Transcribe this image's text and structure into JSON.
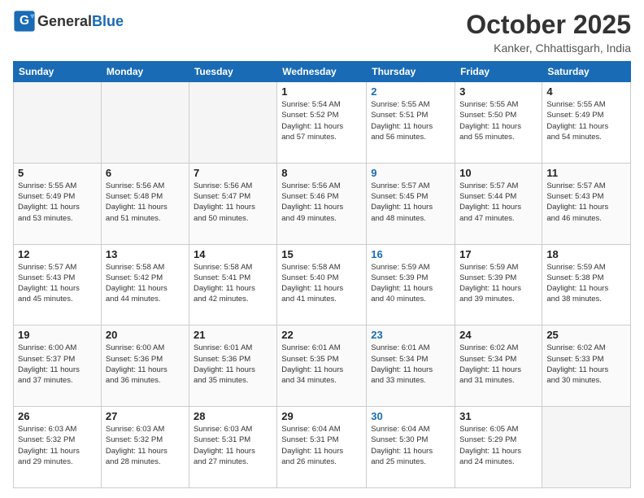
{
  "header": {
    "logo_general": "General",
    "logo_blue": "Blue",
    "month": "October 2025",
    "location": "Kanker, Chhattisgarh, India"
  },
  "days_of_week": [
    "Sunday",
    "Monday",
    "Tuesday",
    "Wednesday",
    "Thursday",
    "Friday",
    "Saturday"
  ],
  "weeks": [
    [
      {
        "day": "",
        "info": ""
      },
      {
        "day": "",
        "info": ""
      },
      {
        "day": "",
        "info": ""
      },
      {
        "day": "1",
        "info": "Sunrise: 5:54 AM\nSunset: 5:52 PM\nDaylight: 11 hours\nand 57 minutes."
      },
      {
        "day": "2",
        "info": "Sunrise: 5:55 AM\nSunset: 5:51 PM\nDaylight: 11 hours\nand 56 minutes."
      },
      {
        "day": "3",
        "info": "Sunrise: 5:55 AM\nSunset: 5:50 PM\nDaylight: 11 hours\nand 55 minutes."
      },
      {
        "day": "4",
        "info": "Sunrise: 5:55 AM\nSunset: 5:49 PM\nDaylight: 11 hours\nand 54 minutes."
      }
    ],
    [
      {
        "day": "5",
        "info": "Sunrise: 5:55 AM\nSunset: 5:49 PM\nDaylight: 11 hours\nand 53 minutes."
      },
      {
        "day": "6",
        "info": "Sunrise: 5:56 AM\nSunset: 5:48 PM\nDaylight: 11 hours\nand 51 minutes."
      },
      {
        "day": "7",
        "info": "Sunrise: 5:56 AM\nSunset: 5:47 PM\nDaylight: 11 hours\nand 50 minutes."
      },
      {
        "day": "8",
        "info": "Sunrise: 5:56 AM\nSunset: 5:46 PM\nDaylight: 11 hours\nand 49 minutes."
      },
      {
        "day": "9",
        "info": "Sunrise: 5:57 AM\nSunset: 5:45 PM\nDaylight: 11 hours\nand 48 minutes."
      },
      {
        "day": "10",
        "info": "Sunrise: 5:57 AM\nSunset: 5:44 PM\nDaylight: 11 hours\nand 47 minutes."
      },
      {
        "day": "11",
        "info": "Sunrise: 5:57 AM\nSunset: 5:43 PM\nDaylight: 11 hours\nand 46 minutes."
      }
    ],
    [
      {
        "day": "12",
        "info": "Sunrise: 5:57 AM\nSunset: 5:43 PM\nDaylight: 11 hours\nand 45 minutes."
      },
      {
        "day": "13",
        "info": "Sunrise: 5:58 AM\nSunset: 5:42 PM\nDaylight: 11 hours\nand 44 minutes."
      },
      {
        "day": "14",
        "info": "Sunrise: 5:58 AM\nSunset: 5:41 PM\nDaylight: 11 hours\nand 42 minutes."
      },
      {
        "day": "15",
        "info": "Sunrise: 5:58 AM\nSunset: 5:40 PM\nDaylight: 11 hours\nand 41 minutes."
      },
      {
        "day": "16",
        "info": "Sunrise: 5:59 AM\nSunset: 5:39 PM\nDaylight: 11 hours\nand 40 minutes."
      },
      {
        "day": "17",
        "info": "Sunrise: 5:59 AM\nSunset: 5:39 PM\nDaylight: 11 hours\nand 39 minutes."
      },
      {
        "day": "18",
        "info": "Sunrise: 5:59 AM\nSunset: 5:38 PM\nDaylight: 11 hours\nand 38 minutes."
      }
    ],
    [
      {
        "day": "19",
        "info": "Sunrise: 6:00 AM\nSunset: 5:37 PM\nDaylight: 11 hours\nand 37 minutes."
      },
      {
        "day": "20",
        "info": "Sunrise: 6:00 AM\nSunset: 5:36 PM\nDaylight: 11 hours\nand 36 minutes."
      },
      {
        "day": "21",
        "info": "Sunrise: 6:01 AM\nSunset: 5:36 PM\nDaylight: 11 hours\nand 35 minutes."
      },
      {
        "day": "22",
        "info": "Sunrise: 6:01 AM\nSunset: 5:35 PM\nDaylight: 11 hours\nand 34 minutes."
      },
      {
        "day": "23",
        "info": "Sunrise: 6:01 AM\nSunset: 5:34 PM\nDaylight: 11 hours\nand 33 minutes."
      },
      {
        "day": "24",
        "info": "Sunrise: 6:02 AM\nSunset: 5:34 PM\nDaylight: 11 hours\nand 31 minutes."
      },
      {
        "day": "25",
        "info": "Sunrise: 6:02 AM\nSunset: 5:33 PM\nDaylight: 11 hours\nand 30 minutes."
      }
    ],
    [
      {
        "day": "26",
        "info": "Sunrise: 6:03 AM\nSunset: 5:32 PM\nDaylight: 11 hours\nand 29 minutes."
      },
      {
        "day": "27",
        "info": "Sunrise: 6:03 AM\nSunset: 5:32 PM\nDaylight: 11 hours\nand 28 minutes."
      },
      {
        "day": "28",
        "info": "Sunrise: 6:03 AM\nSunset: 5:31 PM\nDaylight: 11 hours\nand 27 minutes."
      },
      {
        "day": "29",
        "info": "Sunrise: 6:04 AM\nSunset: 5:31 PM\nDaylight: 11 hours\nand 26 minutes."
      },
      {
        "day": "30",
        "info": "Sunrise: 6:04 AM\nSunset: 5:30 PM\nDaylight: 11 hours\nand 25 minutes."
      },
      {
        "day": "31",
        "info": "Sunrise: 6:05 AM\nSunset: 5:29 PM\nDaylight: 11 hours\nand 24 minutes."
      },
      {
        "day": "",
        "info": ""
      }
    ]
  ],
  "thursday_col": 4
}
